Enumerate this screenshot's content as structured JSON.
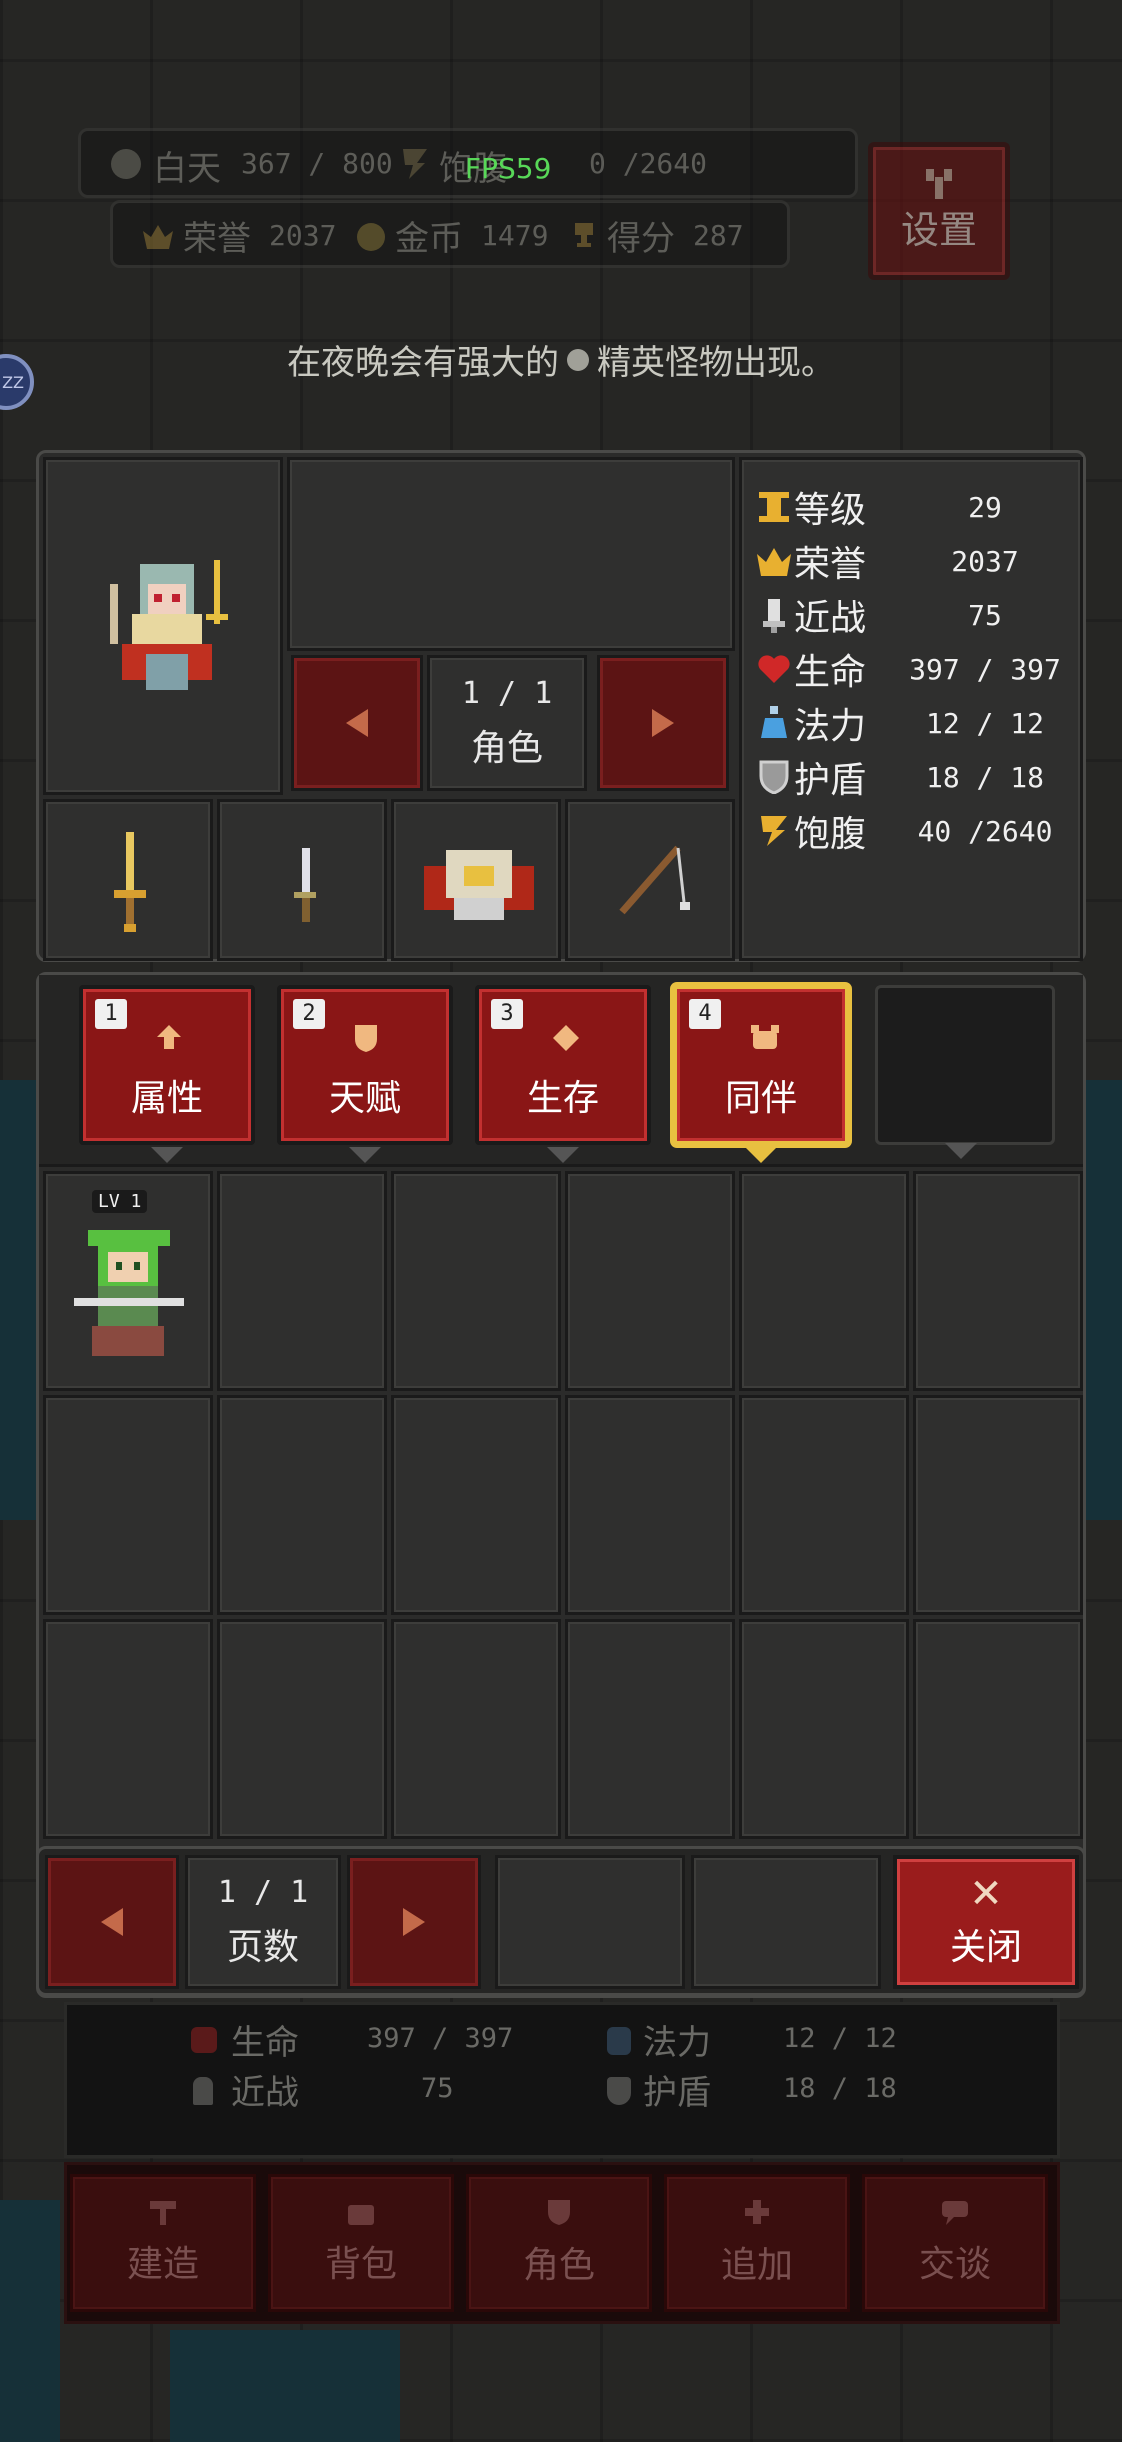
{
  "hud": {
    "day_label": "白天",
    "day_value": "367 / 800",
    "hunger_label": "饱腹",
    "hunger_value": "0 /2640",
    "fps": "FPS59",
    "honor_label": "荣誉",
    "honor_value": "2037",
    "gold_label": "金币",
    "gold_value": "1479",
    "score_label": "得分",
    "score_value": "287",
    "settings_label": "设置",
    "side_badge": "ZZ"
  },
  "notice": {
    "text_before": "在夜晚会有强大的",
    "text_after": "精英怪物出现。"
  },
  "character": {
    "page": "1 / 1",
    "page_label": "角色"
  },
  "stats": [
    {
      "icon": "level-icon",
      "label": "等级",
      "value": "29"
    },
    {
      "icon": "crown-icon",
      "label": "荣誉",
      "value": "2037"
    },
    {
      "icon": "bell-icon",
      "label": "近战",
      "value": "75"
    },
    {
      "icon": "heart-icon",
      "label": "生命",
      "value": "397 / 397"
    },
    {
      "icon": "potion-icon",
      "label": "法力",
      "value": "12 / 12"
    },
    {
      "icon": "shield-icon",
      "label": "护盾",
      "value": "18 / 18"
    },
    {
      "icon": "hunger-icon",
      "label": "饱腹",
      "value": "40 /2640"
    }
  ],
  "tabs": [
    {
      "num": "1",
      "label": "属性"
    },
    {
      "num": "2",
      "label": "天赋"
    },
    {
      "num": "3",
      "label": "生存"
    },
    {
      "num": "4",
      "label": "同伴",
      "selected": true
    }
  ],
  "companion": {
    "level": "LV 1"
  },
  "pager": {
    "page": "1 / 1",
    "label": "页数",
    "close_label": "关闭"
  },
  "bottom": {
    "hp_label": "生命",
    "hp_value": "397 / 397",
    "mp_label": "法力",
    "mp_value": "12 / 12",
    "melee_label": "近战",
    "melee_value": "75",
    "shield_label": "护盾",
    "shield_value": "18 / 18",
    "buttons": [
      "建造",
      "背包",
      "角色",
      "追加",
      "交谈"
    ]
  },
  "colors": {
    "accent_red": "#8a1616",
    "select_gold": "#e8c040",
    "fps_green": "#58d858"
  }
}
